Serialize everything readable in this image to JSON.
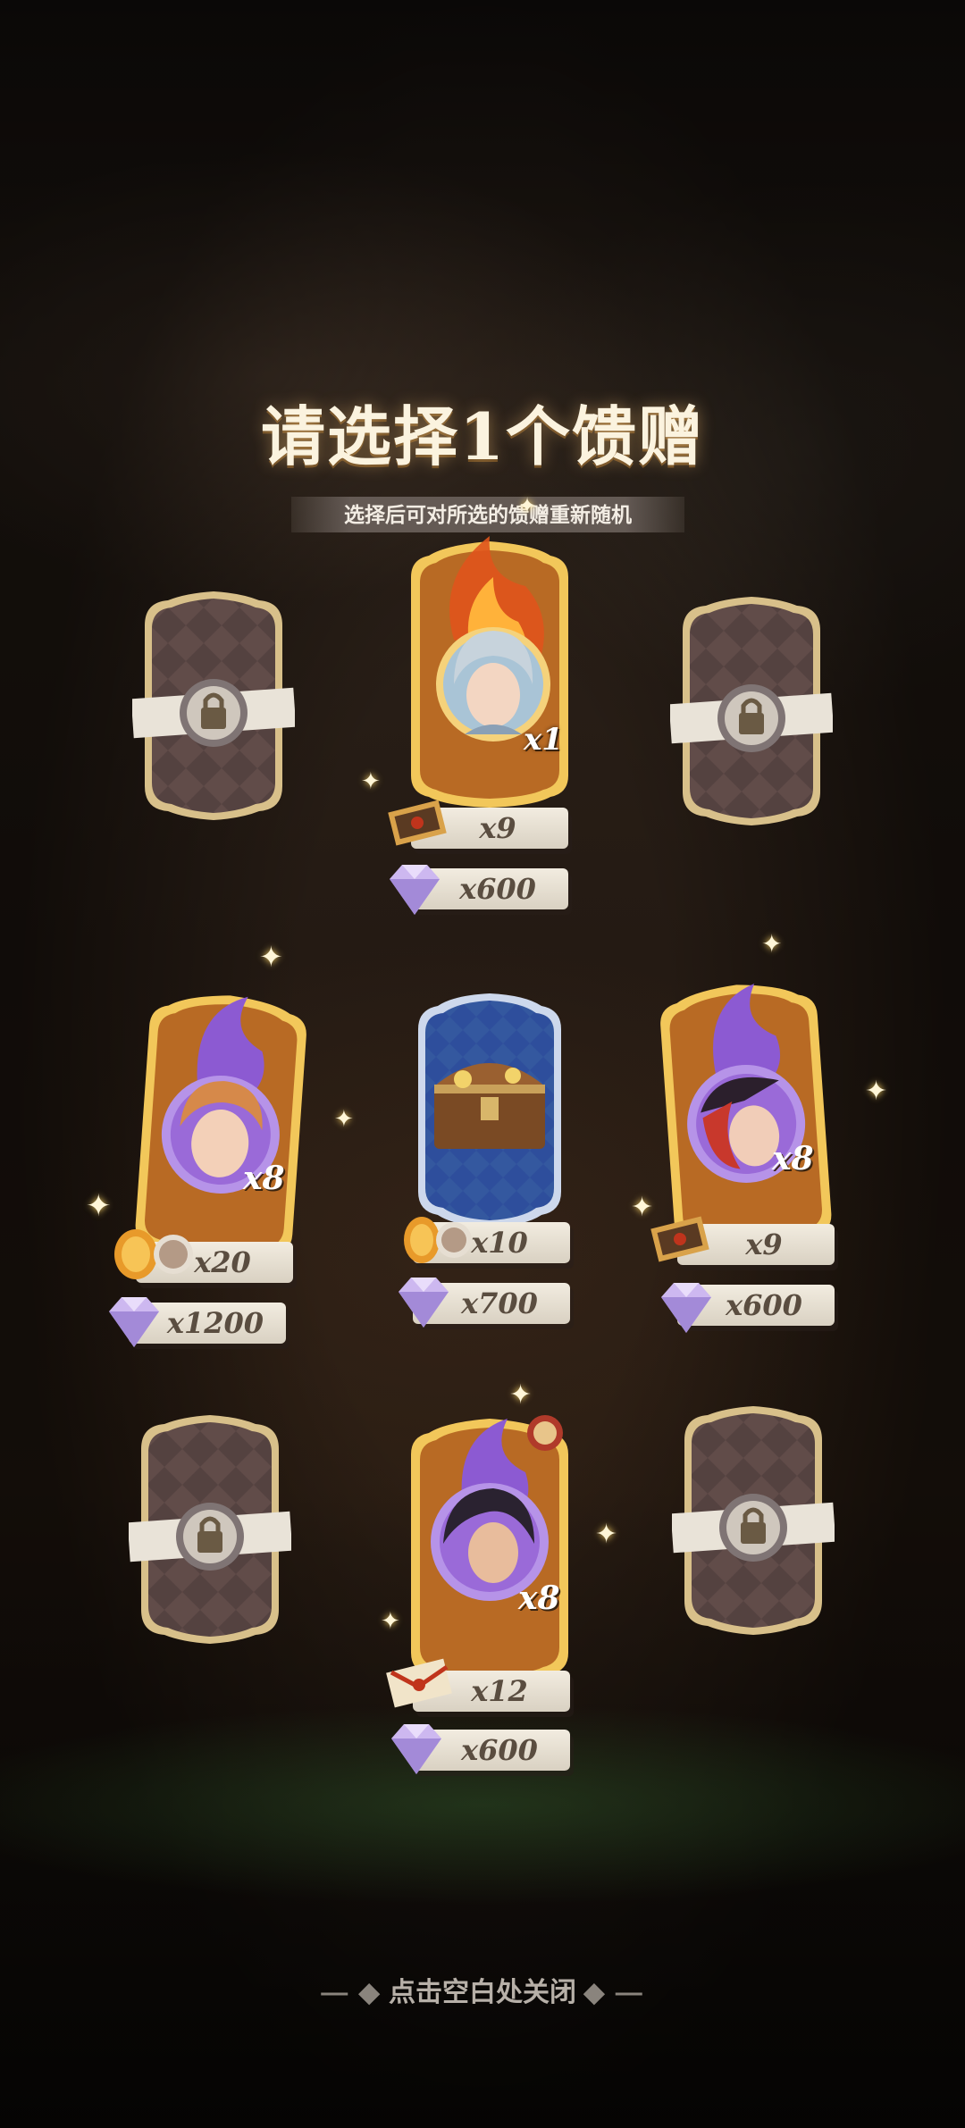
{
  "header": {
    "title": "请选择1个馈赠",
    "subtitle": "选择后可对所选的馈赠重新随机"
  },
  "gifts": [
    {
      "id": "top",
      "character_count": "x1",
      "ticket": "x9",
      "gem": "x600",
      "badge": "fire"
    },
    {
      "id": "mid-left",
      "character_count": "x8",
      "ticket": "x20",
      "gem": "x1200",
      "badge": "shadow"
    },
    {
      "id": "mid-center",
      "character_count": "",
      "ticket": "x10",
      "gem": "x700",
      "badge": "treasure-chest"
    },
    {
      "id": "mid-right",
      "character_count": "x8",
      "ticket": "x9",
      "gem": "x600",
      "badge": "shadow"
    },
    {
      "id": "bottom",
      "character_count": "x8",
      "ticket": "x12",
      "gem": "x600",
      "badge": "shadow"
    }
  ],
  "locked_slots": 4,
  "footer": {
    "close_hint": "点击空白处关闭",
    "dash_left": "— ◆",
    "dash_right": "◆ —"
  },
  "colors": {
    "card_gold": "#f2c75a",
    "card_orange": "#b86a24",
    "card_blue": "#2e4e9c",
    "locked_card": "#5a4a48",
    "shadow_purple": "#8c5ad2"
  }
}
